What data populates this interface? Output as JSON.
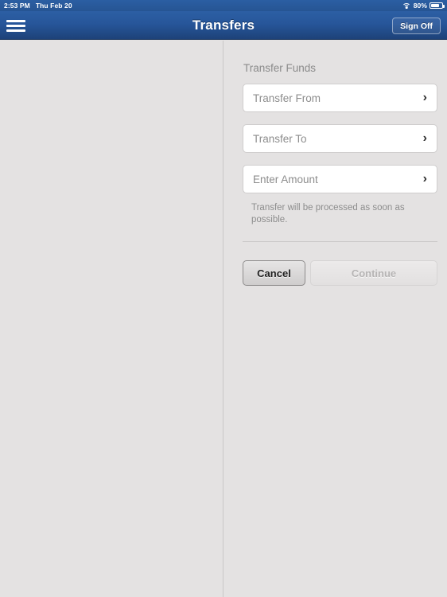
{
  "status_bar": {
    "time": "2:53 PM",
    "date": "Thu Feb 20",
    "wifi_icon": "wifi-icon",
    "battery_percent": "80%",
    "battery_icon": "battery-icon"
  },
  "navbar": {
    "menu_icon": "hamburger-menu-icon",
    "title": "Transfers",
    "sign_off_label": "Sign Off",
    "background_color": "#27569a"
  },
  "main": {
    "section_title": "Transfer Funds",
    "fields": [
      {
        "label": "Transfer From",
        "chevron": "›"
      },
      {
        "label": "Transfer To",
        "chevron": "›"
      },
      {
        "label": "Enter Amount",
        "chevron": "›"
      }
    ],
    "helper_text": "Transfer will be processed as soon as possible.",
    "buttons": {
      "cancel_label": "Cancel",
      "continue_label": "Continue"
    }
  },
  "theme": {
    "background": "#e4e2e2",
    "accent_blue": "#27569a",
    "field_background": "#ffffff",
    "muted_text": "#8d8d8d"
  }
}
